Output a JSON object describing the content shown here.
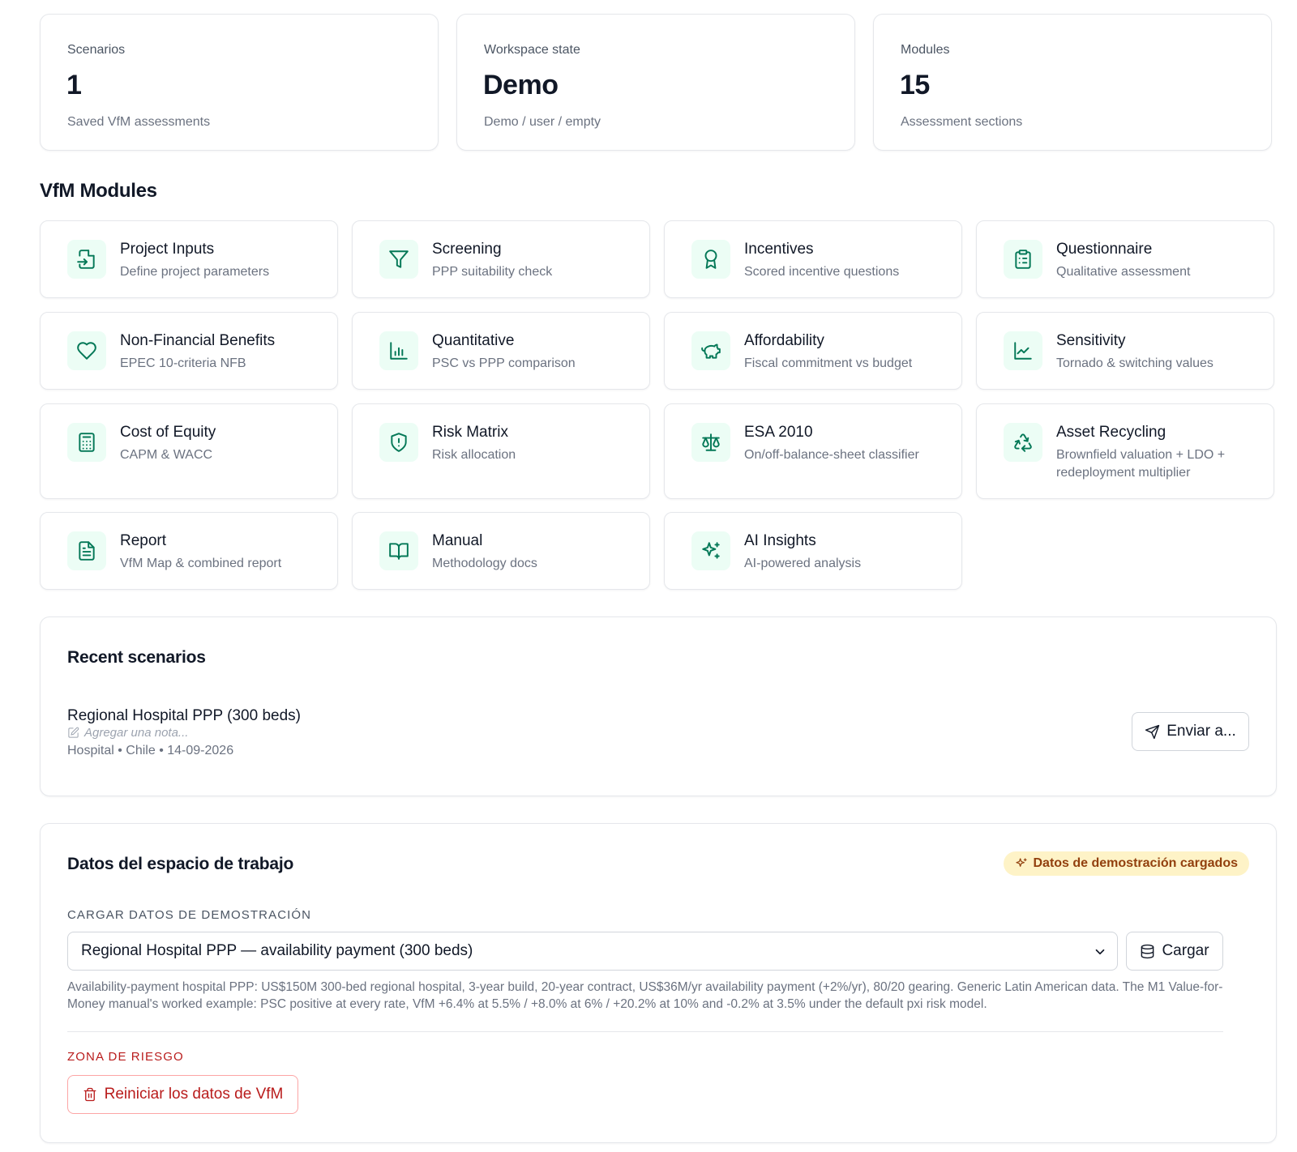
{
  "stats": [
    {
      "label": "Scenarios",
      "value": "1",
      "sub": "Saved VfM assessments"
    },
    {
      "label": "Workspace state",
      "value": "Demo",
      "sub": "Demo / user / empty"
    },
    {
      "label": "Modules",
      "value": "15",
      "sub": "Assessment sections"
    }
  ],
  "modules_title": "VfM Modules",
  "modules": [
    {
      "title": "Project Inputs",
      "desc": "Define project parameters",
      "icon": "file-input-icon"
    },
    {
      "title": "Screening",
      "desc": "PPP suitability check",
      "icon": "filter-icon"
    },
    {
      "title": "Incentives",
      "desc": "Scored incentive questions",
      "icon": "award-icon"
    },
    {
      "title": "Questionnaire",
      "desc": "Qualitative assessment",
      "icon": "clipboard-list-icon"
    },
    {
      "title": "Non-Financial Benefits",
      "desc": "EPEC 10-criteria NFB",
      "icon": "heart-icon"
    },
    {
      "title": "Quantitative",
      "desc": "PSC vs PPP comparison",
      "icon": "bar-chart-icon"
    },
    {
      "title": "Affordability",
      "desc": "Fiscal commitment vs budget",
      "icon": "piggy-bank-icon"
    },
    {
      "title": "Sensitivity",
      "desc": "Tornado & switching values",
      "icon": "line-chart-icon"
    },
    {
      "title": "Cost of Equity",
      "desc": "CAPM & WACC",
      "icon": "calculator-icon"
    },
    {
      "title": "Risk Matrix",
      "desc": "Risk allocation",
      "icon": "shield-alert-icon"
    },
    {
      "title": "ESA 2010",
      "desc": "On/off-balance-sheet classifier",
      "icon": "scale-icon"
    },
    {
      "title": "Asset Recycling",
      "desc": "Brownfield valuation + LDO + redeployment multiplier",
      "icon": "recycle-icon"
    },
    {
      "title": "Report",
      "desc": "VfM Map & combined report",
      "icon": "file-text-icon"
    },
    {
      "title": "Manual",
      "desc": "Methodology docs",
      "icon": "book-open-icon"
    },
    {
      "title": "AI Insights",
      "desc": "AI-powered analysis",
      "icon": "sparkles-icon"
    }
  ],
  "recent": {
    "title": "Recent scenarios",
    "scenario": {
      "name": "Regional Hospital PPP (300 beds)",
      "note_placeholder": "Agregar una nota...",
      "meta": "Hospital • Chile • 14-09-2026",
      "send_label": "Enviar a..."
    }
  },
  "workspace": {
    "title": "Datos del espacio de trabajo",
    "badge": "Datos de demostración cargados",
    "demo_label": "CARGAR DATOS DE DEMOSTRACIÓN",
    "selected_demo": "Regional Hospital PPP — availability payment (300 beds)",
    "load_label": "Cargar",
    "description": "Availability-payment hospital PPP: US$150M 300-bed regional hospital, 3-year build, 20-year contract, US$36M/yr availability payment (+2%/yr), 80/20 gearing. Generic Latin American data. The M1 Value-for-Money manual's worked example: PSC positive at every rate, VfM +6.4% at 5.5% / +8.0% at 6% / +20.2% at 10% and -0.2% at 3.5% under the default pxi risk model.",
    "danger_label": "ZONA DE RIESGO",
    "reset_label": "Reiniciar los datos de VfM"
  }
}
